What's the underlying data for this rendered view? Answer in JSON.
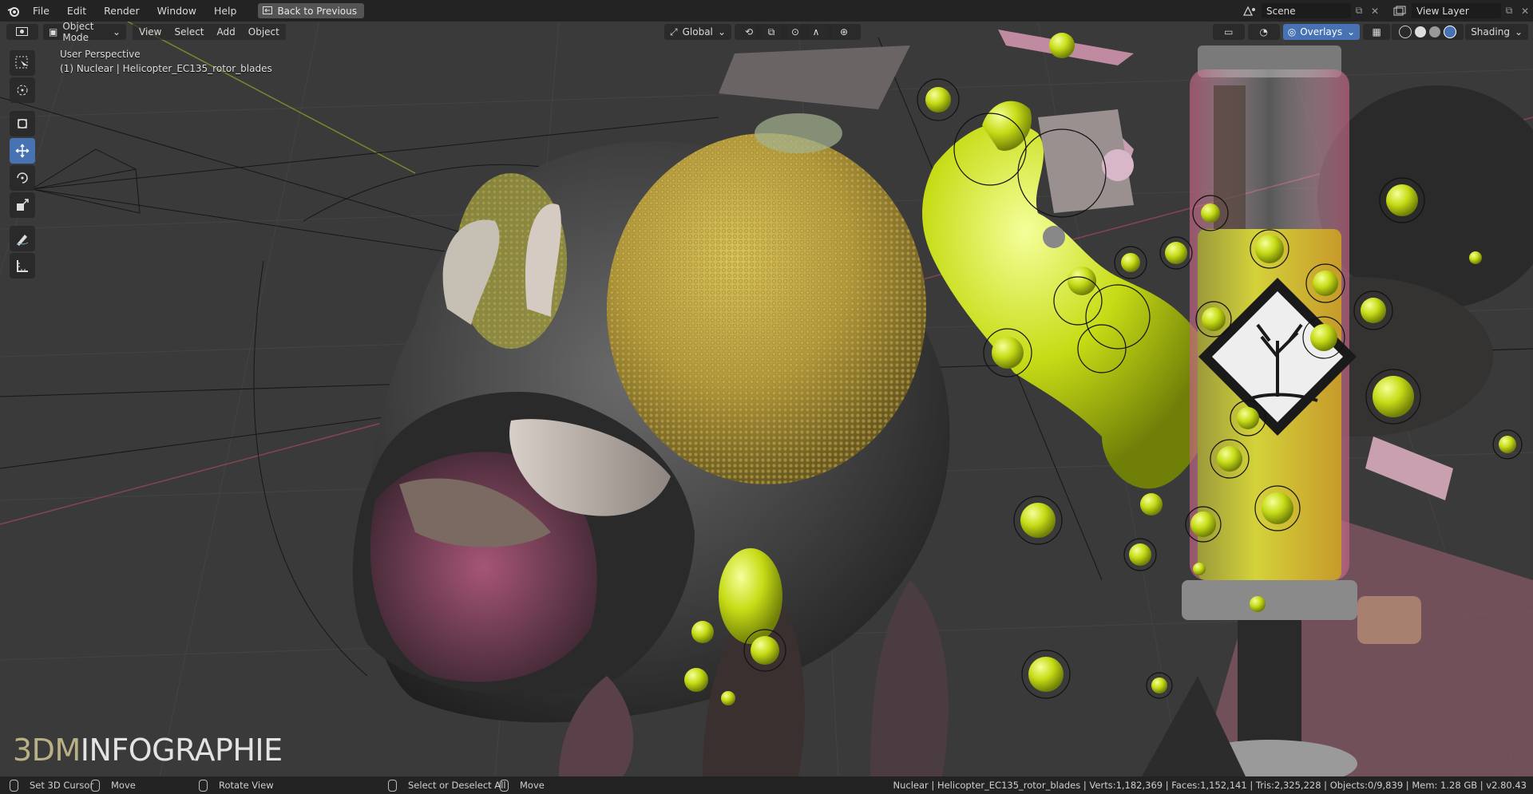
{
  "menu": {
    "items": [
      "File",
      "Edit",
      "Render",
      "Window",
      "Help"
    ],
    "back_button": "Back to Previous"
  },
  "top_right": {
    "scene": "Scene",
    "view_layer": "View Layer"
  },
  "viewport_header": {
    "mode": "Object Mode",
    "menus": [
      "View",
      "Select",
      "Add",
      "Object"
    ],
    "orientation": "Global",
    "overlays": "Overlays",
    "shading": "Shading"
  },
  "viewport": {
    "perspective": "User Perspective",
    "active_object": "(1) Nuclear | Helicopter_EC135_rotor_blades"
  },
  "watermark": {
    "part1": "3DM",
    "part2": "INFOGRAPHIE"
  },
  "statusbar": {
    "left": [
      "Set 3D Cursor",
      "Move",
      "Rotate View",
      "Select or Deselect All",
      "Move"
    ],
    "right": "Nuclear | Helicopter_EC135_rotor_blades | Verts:1,182,369 | Faces:1,152,141 | Tris:2,325,228 | Objects:0/9,839 | Mem: 1.28 GB | v2.80.43"
  },
  "colors": {
    "accent": "#4772b3",
    "topbar": "#232323",
    "grid": "#3d3d3d"
  }
}
